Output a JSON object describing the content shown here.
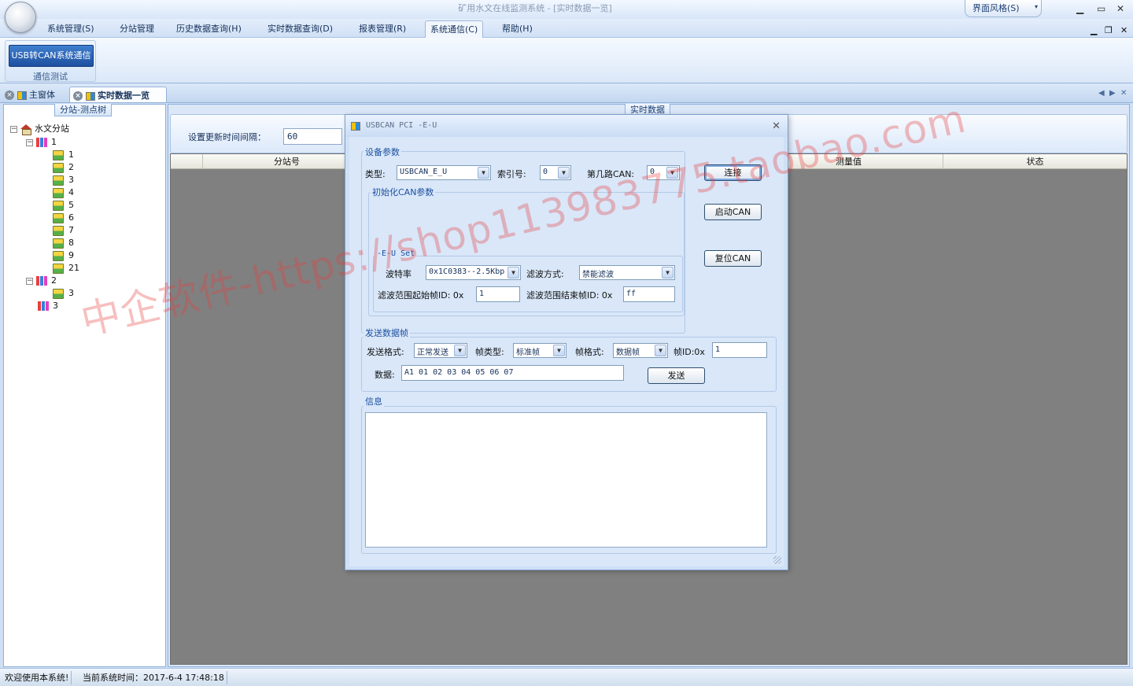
{
  "window": {
    "title": "矿用水文在线监测系统 - [实时数据一览]",
    "skin_label": "界面风格(S)",
    "skin_arrow": "▾",
    "minimize": "▁",
    "maximize": "▭",
    "close": "✕"
  },
  "menu": {
    "items": [
      {
        "label": "系统管理(S)"
      },
      {
        "label": "分站管理"
      },
      {
        "label": "历史数据查询(H)"
      },
      {
        "label": "实时数据查询(D)"
      },
      {
        "label": "报表管理(R)"
      },
      {
        "label": "系统通信(C)"
      },
      {
        "label": "帮助(H)"
      }
    ],
    "active_index": 5,
    "mdi_min": "▁",
    "mdi_restore": "❐",
    "mdi_close": "✕"
  },
  "ribbon": {
    "button_label": "USB转CAN系统通信",
    "group_label": "通信测试"
  },
  "tabs": [
    {
      "label": "主窗体",
      "active": false
    },
    {
      "label": "实时数据一览",
      "active": true
    }
  ],
  "tab_nav": {
    "left": "◀",
    "right": "▶",
    "close": "✕"
  },
  "left_panel": {
    "caption": "分站-测点树",
    "tree": [
      {
        "label": "水文分站",
        "level": 0,
        "icon": "home-icon",
        "expander": "−"
      },
      {
        "label": "1",
        "level": 1,
        "icon": "bar-chart-icon",
        "expander": "−"
      },
      {
        "label": "1",
        "level": 2,
        "icon": "node-icon"
      },
      {
        "label": "2",
        "level": 2,
        "icon": "node-icon"
      },
      {
        "label": "3",
        "level": 2,
        "icon": "node-icon"
      },
      {
        "label": "4",
        "level": 2,
        "icon": "node-icon"
      },
      {
        "label": "5",
        "level": 2,
        "icon": "node-icon"
      },
      {
        "label": "6",
        "level": 2,
        "icon": "node-icon"
      },
      {
        "label": "7",
        "level": 2,
        "icon": "node-icon"
      },
      {
        "label": "8",
        "level": 2,
        "icon": "node-icon"
      },
      {
        "label": "9",
        "level": 2,
        "icon": "node-icon"
      },
      {
        "label": "21",
        "level": 2,
        "icon": "node-icon"
      },
      {
        "label": "2",
        "level": 1,
        "icon": "bar-chart-icon",
        "expander": "−"
      },
      {
        "label": "3",
        "level": 2,
        "icon": "node-icon"
      },
      {
        "label": "3",
        "level": 1,
        "icon": "bar-chart-icon"
      }
    ]
  },
  "right_panel": {
    "caption": "实时数据",
    "interval_label": "设置更新时间间隔：",
    "interval_value": "60",
    "columns": [
      "分站号",
      "测量值",
      "状态"
    ]
  },
  "status_bar": {
    "welcome": "欢迎使用本系统!",
    "time": "当前系统时间：2017-6-4 17:48:18"
  },
  "dialog": {
    "title": "USBCAN  PCI  -E-U",
    "close": "✕",
    "device_params": {
      "legend": "设备参数",
      "type_label": "类型:",
      "type_value": "USBCAN_E_U",
      "index_label": "索引号:",
      "index_value": "0",
      "can_label": "第几路CAN:",
      "can_value": "0"
    },
    "init_can": {
      "legend": "初始化CAN参数",
      "sub_legend": "-E-U Set",
      "baud_label": "波特率",
      "baud_value": "0x1C0383--2.5Kbp",
      "filter_label": "滤波方式:",
      "filter_value": "禁能滤波",
      "start_id_label": "滤波范围起始帧ID: 0x",
      "start_id_value": "1",
      "end_id_label": "滤波范围结束帧ID: 0x",
      "end_id_value": "ff"
    },
    "buttons": {
      "connect": "连接",
      "start_can": "启动CAN",
      "reset_can": "复位CAN",
      "send": "发送"
    },
    "send_frame": {
      "legend": "发送数据帧",
      "format_label": "发送格式:",
      "format_value": "正常发送",
      "frame_type_label": "帧类型:",
      "frame_type_value": "标准帧",
      "frame_format_label": "帧格式:",
      "frame_format_value": "数据帧",
      "frame_id_label": "帧ID:0x",
      "frame_id_value": "1",
      "data_label": "数据:",
      "data_value": "A1 01 02 03 04 05 06 07"
    },
    "info": {
      "legend": "信息"
    }
  },
  "watermark": "中企软件-https://shop113983775.taobao.com",
  "colors": {
    "accent": "#1d4f9f",
    "panel_bg": "#dbe7f7",
    "grid_bg": "#808080",
    "watermark": "#e83c3c"
  }
}
